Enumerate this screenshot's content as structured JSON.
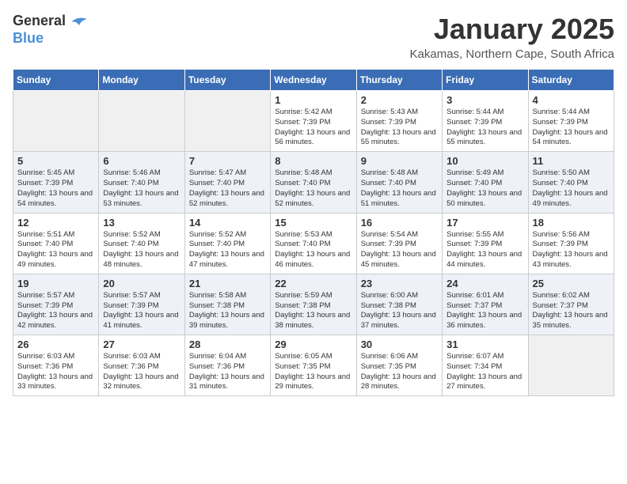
{
  "header": {
    "logo_general": "General",
    "logo_blue": "Blue",
    "month_title": "January 2025",
    "location": "Kakamas, Northern Cape, South Africa"
  },
  "days_of_week": [
    "Sunday",
    "Monday",
    "Tuesday",
    "Wednesday",
    "Thursday",
    "Friday",
    "Saturday"
  ],
  "weeks": [
    [
      {
        "day": "",
        "info": ""
      },
      {
        "day": "",
        "info": ""
      },
      {
        "day": "",
        "info": ""
      },
      {
        "day": "1",
        "info": "Sunrise: 5:42 AM\nSunset: 7:39 PM\nDaylight: 13 hours and 56 minutes."
      },
      {
        "day": "2",
        "info": "Sunrise: 5:43 AM\nSunset: 7:39 PM\nDaylight: 13 hours and 55 minutes."
      },
      {
        "day": "3",
        "info": "Sunrise: 5:44 AM\nSunset: 7:39 PM\nDaylight: 13 hours and 55 minutes."
      },
      {
        "day": "4",
        "info": "Sunrise: 5:44 AM\nSunset: 7:39 PM\nDaylight: 13 hours and 54 minutes."
      }
    ],
    [
      {
        "day": "5",
        "info": "Sunrise: 5:45 AM\nSunset: 7:39 PM\nDaylight: 13 hours and 54 minutes."
      },
      {
        "day": "6",
        "info": "Sunrise: 5:46 AM\nSunset: 7:40 PM\nDaylight: 13 hours and 53 minutes."
      },
      {
        "day": "7",
        "info": "Sunrise: 5:47 AM\nSunset: 7:40 PM\nDaylight: 13 hours and 52 minutes."
      },
      {
        "day": "8",
        "info": "Sunrise: 5:48 AM\nSunset: 7:40 PM\nDaylight: 13 hours and 52 minutes."
      },
      {
        "day": "9",
        "info": "Sunrise: 5:48 AM\nSunset: 7:40 PM\nDaylight: 13 hours and 51 minutes."
      },
      {
        "day": "10",
        "info": "Sunrise: 5:49 AM\nSunset: 7:40 PM\nDaylight: 13 hours and 50 minutes."
      },
      {
        "day": "11",
        "info": "Sunrise: 5:50 AM\nSunset: 7:40 PM\nDaylight: 13 hours and 49 minutes."
      }
    ],
    [
      {
        "day": "12",
        "info": "Sunrise: 5:51 AM\nSunset: 7:40 PM\nDaylight: 13 hours and 49 minutes."
      },
      {
        "day": "13",
        "info": "Sunrise: 5:52 AM\nSunset: 7:40 PM\nDaylight: 13 hours and 48 minutes."
      },
      {
        "day": "14",
        "info": "Sunrise: 5:52 AM\nSunset: 7:40 PM\nDaylight: 13 hours and 47 minutes."
      },
      {
        "day": "15",
        "info": "Sunrise: 5:53 AM\nSunset: 7:40 PM\nDaylight: 13 hours and 46 minutes."
      },
      {
        "day": "16",
        "info": "Sunrise: 5:54 AM\nSunset: 7:39 PM\nDaylight: 13 hours and 45 minutes."
      },
      {
        "day": "17",
        "info": "Sunrise: 5:55 AM\nSunset: 7:39 PM\nDaylight: 13 hours and 44 minutes."
      },
      {
        "day": "18",
        "info": "Sunrise: 5:56 AM\nSunset: 7:39 PM\nDaylight: 13 hours and 43 minutes."
      }
    ],
    [
      {
        "day": "19",
        "info": "Sunrise: 5:57 AM\nSunset: 7:39 PM\nDaylight: 13 hours and 42 minutes."
      },
      {
        "day": "20",
        "info": "Sunrise: 5:57 AM\nSunset: 7:39 PM\nDaylight: 13 hours and 41 minutes."
      },
      {
        "day": "21",
        "info": "Sunrise: 5:58 AM\nSunset: 7:38 PM\nDaylight: 13 hours and 39 minutes."
      },
      {
        "day": "22",
        "info": "Sunrise: 5:59 AM\nSunset: 7:38 PM\nDaylight: 13 hours and 38 minutes."
      },
      {
        "day": "23",
        "info": "Sunrise: 6:00 AM\nSunset: 7:38 PM\nDaylight: 13 hours and 37 minutes."
      },
      {
        "day": "24",
        "info": "Sunrise: 6:01 AM\nSunset: 7:37 PM\nDaylight: 13 hours and 36 minutes."
      },
      {
        "day": "25",
        "info": "Sunrise: 6:02 AM\nSunset: 7:37 PM\nDaylight: 13 hours and 35 minutes."
      }
    ],
    [
      {
        "day": "26",
        "info": "Sunrise: 6:03 AM\nSunset: 7:36 PM\nDaylight: 13 hours and 33 minutes."
      },
      {
        "day": "27",
        "info": "Sunrise: 6:03 AM\nSunset: 7:36 PM\nDaylight: 13 hours and 32 minutes."
      },
      {
        "day": "28",
        "info": "Sunrise: 6:04 AM\nSunset: 7:36 PM\nDaylight: 13 hours and 31 minutes."
      },
      {
        "day": "29",
        "info": "Sunrise: 6:05 AM\nSunset: 7:35 PM\nDaylight: 13 hours and 29 minutes."
      },
      {
        "day": "30",
        "info": "Sunrise: 6:06 AM\nSunset: 7:35 PM\nDaylight: 13 hours and 28 minutes."
      },
      {
        "day": "31",
        "info": "Sunrise: 6:07 AM\nSunset: 7:34 PM\nDaylight: 13 hours and 27 minutes."
      },
      {
        "day": "",
        "info": ""
      }
    ]
  ]
}
